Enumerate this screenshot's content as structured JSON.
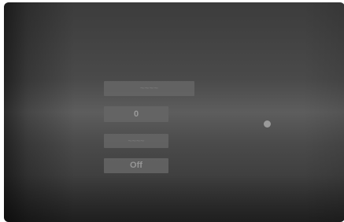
{
  "menu": {
    "top_label": "~~~~",
    "value_label": "0",
    "mid_label": "~~~~",
    "off_label": "Off"
  }
}
